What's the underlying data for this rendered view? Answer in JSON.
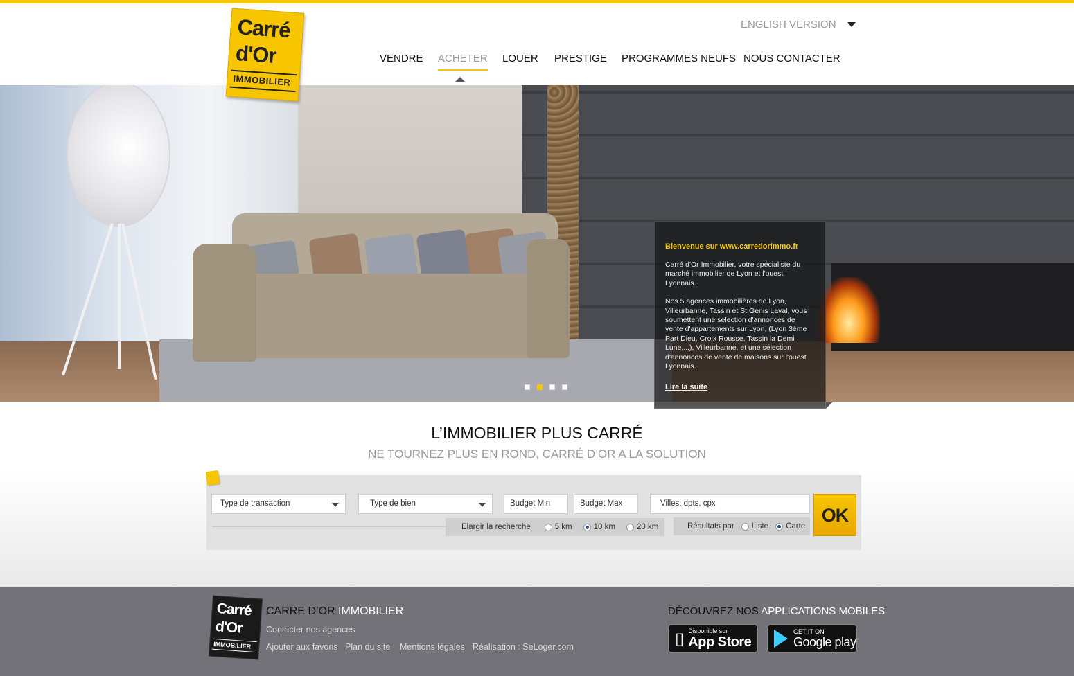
{
  "brand": {
    "logo_line1": "Carré",
    "logo_line2": "d'Or",
    "logo_line3": "IMMOBILIER",
    "accent_color": "#f7c600"
  },
  "header": {
    "language_label": "ENGLISH VERSION",
    "nav": [
      {
        "label": "VENDRE",
        "active": false
      },
      {
        "label": "ACHETER",
        "active": true
      },
      {
        "label": "LOUER",
        "active": false
      },
      {
        "label": "PRESTIGE",
        "active": false
      },
      {
        "label": "PROGRAMMES NEUFS",
        "active": false
      },
      {
        "label": "NOUS CONTACTER",
        "active": false
      }
    ]
  },
  "hero": {
    "welcome_title": "Bienvenue sur www.carredorimmo.fr",
    "welcome_p1": "Carré d'Or Immobilier, votre spécialiste du marché immobilier de Lyon et l'ouest Lyonnais.",
    "welcome_p2": "Nos 5 agences immobilières de Lyon, Villeurbanne, Tassin et St Genis Laval, vous soumettent une sélection d'annonces de vente d'appartements sur Lyon, (Lyon 3ème Part Dieu, Croix Rousse, Tassin la Demi Lune,...), Villeurbanne, et une sélection d'annonces de vente de maisons sur l'ouest Lyonnais.",
    "read_more": "Lire la suite",
    "slides_count": 4,
    "active_slide": 2
  },
  "tagline": {
    "title": "L’IMMOBILIER PLUS CARRÉ",
    "subtitle": "NE TOURNEZ PLUS EN ROND, CARRÉ D’OR A LA SOLUTION"
  },
  "search": {
    "transaction_placeholder": "Type de transaction",
    "property_placeholder": "Type de bien",
    "budget_min": "Budget Min",
    "budget_max": "Budget Max",
    "location_placeholder": "Villes, dpts, cpx",
    "ok_label": "OK",
    "radius_label": "Elargir la recherche",
    "radius_options": [
      {
        "label": "5 km",
        "checked": false
      },
      {
        "label": "10 km",
        "checked": true
      },
      {
        "label": "20 km",
        "checked": false
      }
    ],
    "results_label": "Résultats par",
    "results_options": [
      {
        "label": "Liste",
        "checked": false
      },
      {
        "label": "Carte",
        "checked": true
      }
    ]
  },
  "footer": {
    "company_prefix": "CARRE D’OR",
    "company_suffix": "IMMOBILIER",
    "contact_link": "Contacter nos agences",
    "links": [
      "Ajouter aux favoris",
      "Plan du site",
      "Mentions légales",
      "Réalisation : SeLoger.com"
    ],
    "apps_prefix": "DÉCOUVREZ NOS",
    "apps_suffix": "APPLICATIONS MOBILES",
    "appstore_small": "Disponible sur",
    "appstore_big": "App Store",
    "googleplay_small": "GET IT ON",
    "googleplay_big": "Google play"
  }
}
